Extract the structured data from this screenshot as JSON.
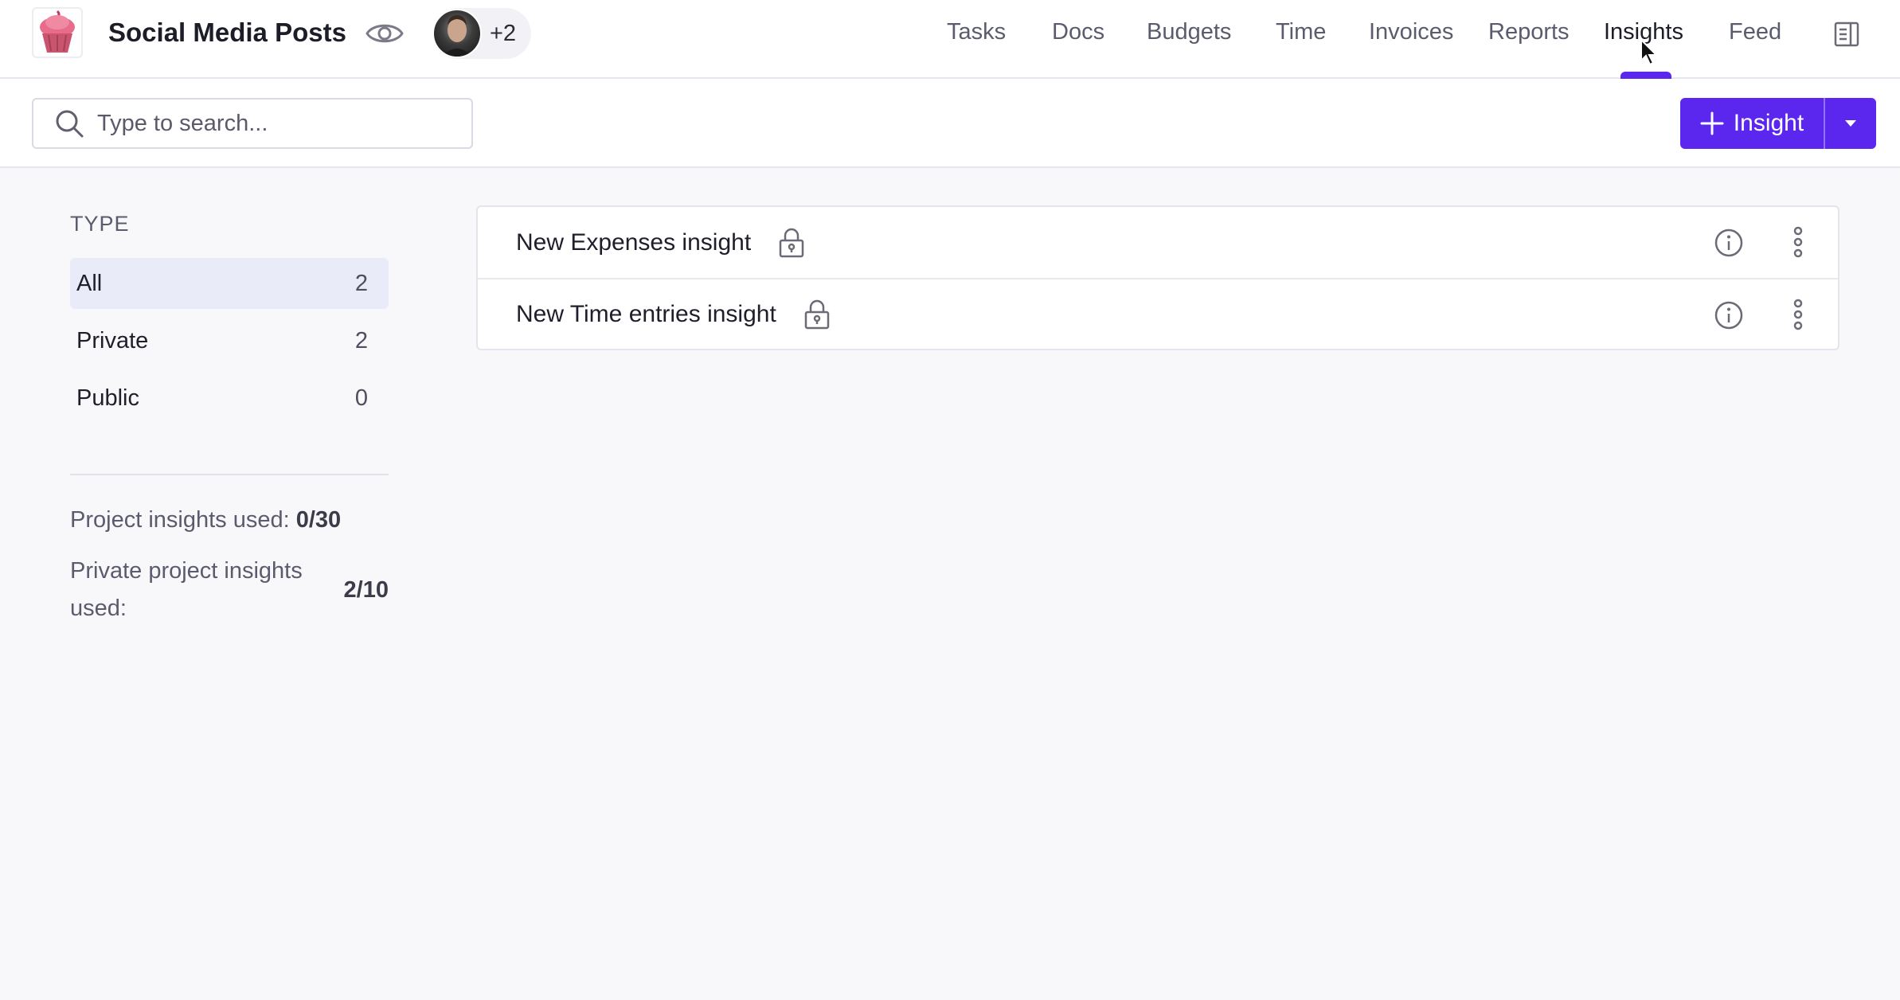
{
  "header": {
    "project_title": "Social Media Posts",
    "members_extra": "+2",
    "nav": [
      "Tasks",
      "Docs",
      "Budgets",
      "Time",
      "Invoices",
      "Reports",
      "Insights",
      "Feed"
    ],
    "active_nav": "Insights"
  },
  "toolbar": {
    "search_placeholder": "Type to search...",
    "add_label": "Insight"
  },
  "sidebar": {
    "heading": "TYPE",
    "filters": [
      {
        "label": "All",
        "count": "2"
      },
      {
        "label": "Private",
        "count": "2"
      },
      {
        "label": "Public",
        "count": "0"
      }
    ],
    "usage_project_label": "Project insights used:",
    "usage_project_value": "0/30",
    "usage_private_label": "Private project insights used:",
    "usage_private_value": "2/10"
  },
  "insights": [
    {
      "title": "New Expenses insight"
    },
    {
      "title": "New Time entries insight"
    }
  ],
  "colors": {
    "accent": "#5b27ee",
    "page_bg": "#f8f8fb",
    "active_filter_bg": "#e9ecf8"
  },
  "icons": [
    "cupcake-logo-icon",
    "eye-icon",
    "avatar",
    "docs-panel-icon",
    "search-icon",
    "plus-icon",
    "caret-down-icon",
    "lock-icon",
    "info-icon",
    "more-vertical-icon",
    "cursor-icon"
  ]
}
